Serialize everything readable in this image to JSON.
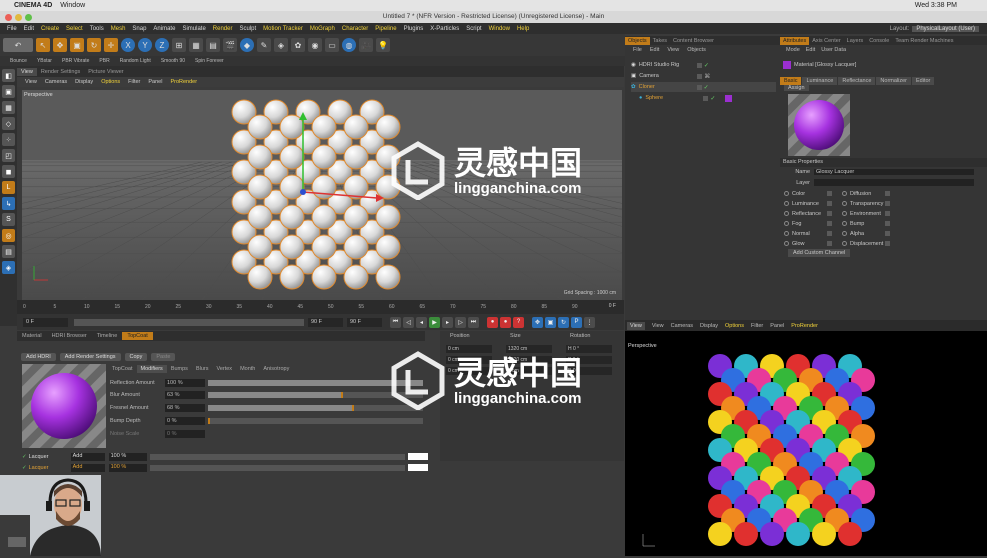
{
  "mac": {
    "apple": "",
    "app": "CINEMA 4D",
    "menu_window": "Window",
    "clock": "Wed 3:38 PM"
  },
  "window": {
    "title": "Untitled 7 * (NFR Version - Restricted License) (Unregistered License) - Main",
    "layout_label": "Layout:",
    "layout_value": "PhysicalLayout (User)"
  },
  "menu": [
    "File",
    "Edit",
    "Create",
    "Select",
    "Tools",
    "Mesh",
    "Snap",
    "Animate",
    "Simulate",
    "Render",
    "Sculpt",
    "Motion Tracker",
    "MoGraph",
    "Character",
    "Pipeline",
    "Plugins",
    "X-Particles",
    "Script",
    "Window",
    "Help"
  ],
  "toolbar": {
    "x": "X",
    "y": "Y",
    "z": "Z"
  },
  "plugins": [
    "Bounce",
    "YBstar",
    "PBR Vibrate",
    "PBR",
    "Random Light",
    "Smooth 90",
    "Spin Forever"
  ],
  "viewport": {
    "tabs": [
      "View",
      "Render Settings",
      "Picture Viewer"
    ],
    "menu": [
      "View",
      "Cameras",
      "Display",
      "Options",
      "Filter",
      "Panel",
      "ProRender"
    ],
    "label": "Perspective",
    "grid": "Grid Spacing : 1000 cm"
  },
  "timeline": {
    "ticks": [
      "0",
      "5",
      "10",
      "15",
      "20",
      "25",
      "30",
      "35",
      "40",
      "45",
      "50",
      "55",
      "60",
      "65",
      "70",
      "75",
      "80",
      "85",
      "90"
    ],
    "frame_end": "0 F",
    "start": "0 F",
    "cur": "90 F",
    "end": "90 F"
  },
  "material": {
    "tabs": [
      "Material",
      "HDRI Browser",
      "Timeline",
      "TopCoat"
    ],
    "buttons": [
      "Add HDRI",
      "Add Render Settings",
      "Copy",
      "Paste"
    ],
    "layer_tabs": [
      "TopCoat",
      "Modifiers",
      "Bumps",
      "Blurs",
      "Vertex",
      "Month",
      "Anisotropy"
    ],
    "props": [
      {
        "label": "Reflection Amount",
        "value": "100 %"
      },
      {
        "label": "Blur Amount",
        "value": "63 %"
      },
      {
        "label": "Fresnel Amount",
        "value": "68 %"
      },
      {
        "label": "Bump Depth",
        "value": "0 %"
      },
      {
        "label": "Noise Scale",
        "value": "0 %"
      }
    ],
    "layers": [
      {
        "name": "Lacquer",
        "mode": "Add",
        "pct": "100 %"
      },
      {
        "name": "Lacquer",
        "mode": "Add",
        "pct": "100 %"
      }
    ]
  },
  "coords": {
    "head": [
      "Position",
      "Size",
      "Rotation"
    ],
    "rows": [
      [
        "0 cm",
        "1320 cm",
        "H  0 °"
      ],
      [
        "0 cm",
        "1320 cm",
        "P  0 °"
      ],
      [
        "0 cm",
        "0 cm",
        "B  0 °"
      ]
    ]
  },
  "objects": {
    "tabs": [
      "Objects",
      "Takes",
      "Content Browser"
    ],
    "menu": [
      "File",
      "Edit",
      "View",
      "Objects"
    ],
    "items": [
      "HDRI Studio Rig",
      "Camera",
      "Cloner",
      "Sphere"
    ]
  },
  "attributes": {
    "tabs": [
      "Attributes",
      "Axis Center",
      "Layers",
      "Console",
      "Team Render Machines"
    ],
    "menu": [
      "Mode",
      "Edit",
      "User Data"
    ],
    "material_title": "Material [Glossy Lacquer]",
    "sub": [
      "Basic",
      "Luminance",
      "Reflectance",
      "Normalizer",
      "Editor"
    ],
    "assign": "Assign",
    "section": "Basic Properties",
    "name_label": "Name",
    "name_value": "Glossy Lacquer",
    "layer_label": "Layer",
    "channels_left": [
      "Color",
      "Luminance",
      "Reflectance",
      "Fog",
      "Normal",
      "Glow"
    ],
    "channels_right": [
      "Diffusion",
      "Transparency",
      "Environment",
      "Bump",
      "Alpha",
      "Displacement"
    ],
    "add_channel": "Add Custom Channel"
  },
  "rview": {
    "tab": "View",
    "menu": [
      "View",
      "Cameras",
      "Display",
      "Options",
      "Filter",
      "Panel",
      "ProRender"
    ],
    "label": "Perspective"
  },
  "watermark": {
    "cn": "灵感中国",
    "url": "lingganchina.com"
  },
  "colors": {
    "accent": "#c27c19",
    "blue": "#2c6fb5",
    "purple": "#8b2fc9"
  }
}
